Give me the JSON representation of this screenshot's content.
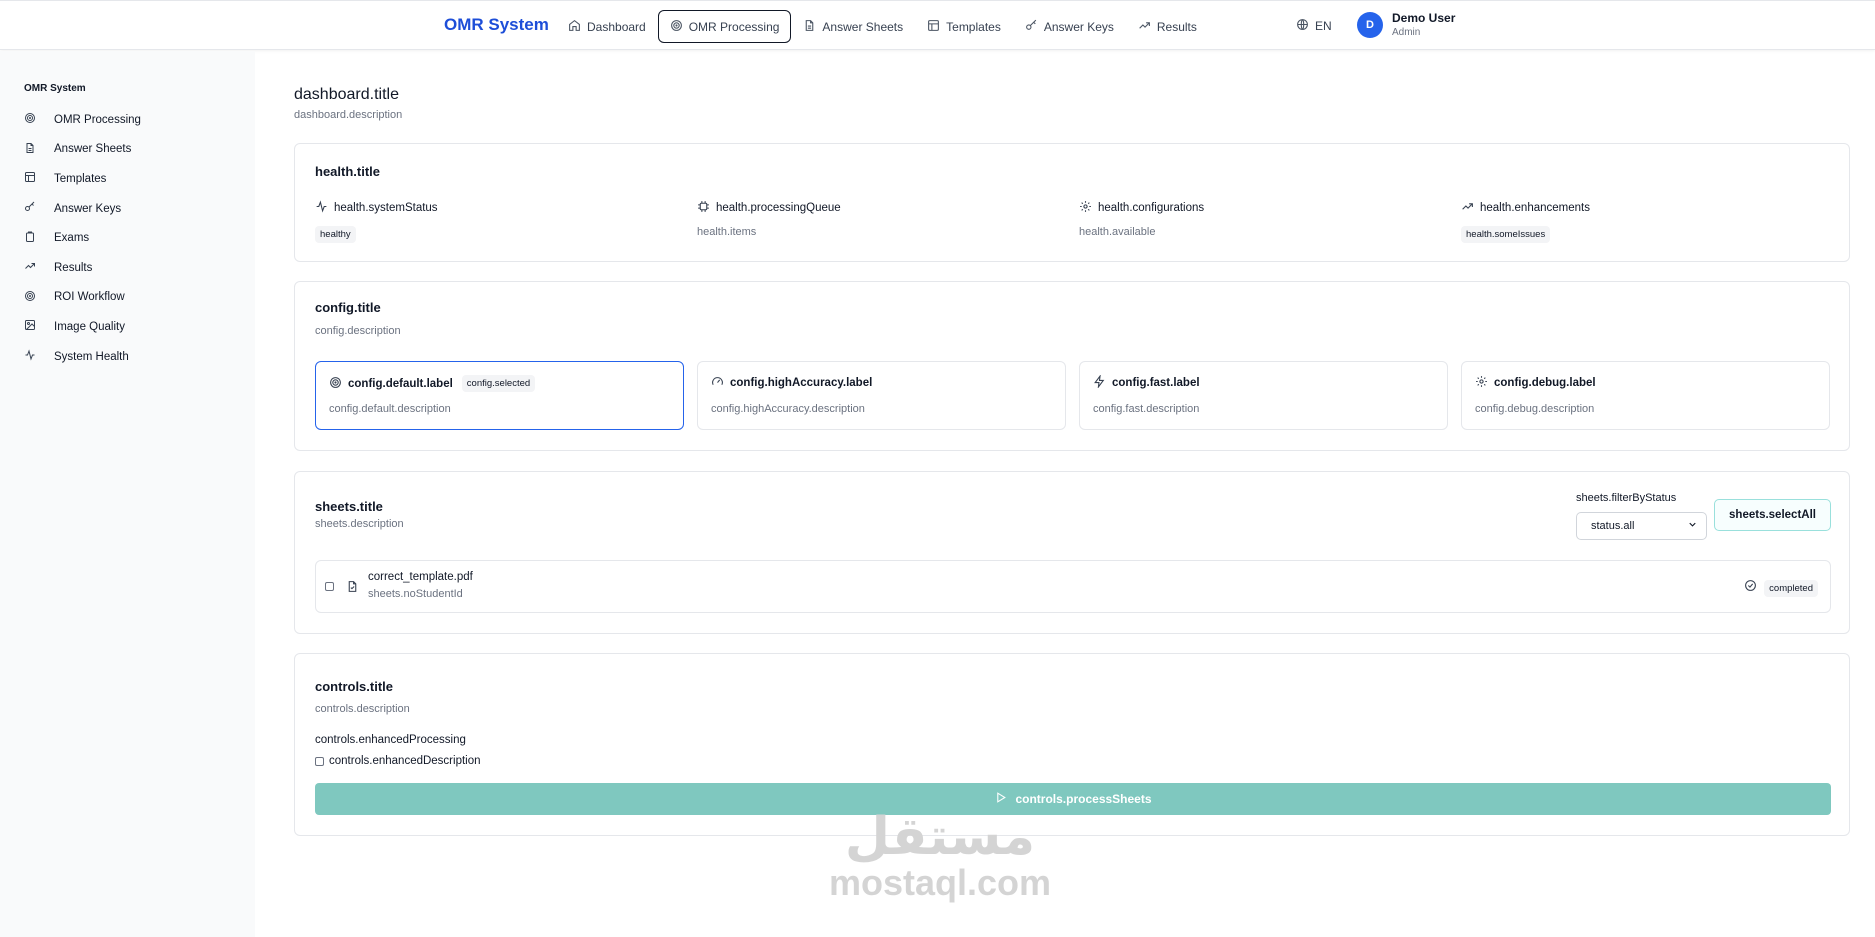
{
  "header": {
    "brand": "OMR System",
    "nav": [
      {
        "label": "Dashboard",
        "icon": "home-icon"
      },
      {
        "label": "OMR Processing",
        "icon": "target-icon",
        "active": true
      },
      {
        "label": "Answer Sheets",
        "icon": "file-icon"
      },
      {
        "label": "Templates",
        "icon": "layout-icon"
      },
      {
        "label": "Answer Keys",
        "icon": "key-icon"
      },
      {
        "label": "Results",
        "icon": "trending-up-icon"
      }
    ],
    "language": "EN",
    "user": {
      "initial": "D",
      "name": "Demo User",
      "role": "Admin"
    }
  },
  "sidebar": {
    "title": "OMR System",
    "items": [
      {
        "label": "OMR Processing",
        "icon": "target-icon"
      },
      {
        "label": "Answer Sheets",
        "icon": "file-icon"
      },
      {
        "label": "Templates",
        "icon": "layout-icon"
      },
      {
        "label": "Answer Keys",
        "icon": "key-icon"
      },
      {
        "label": "Exams",
        "icon": "clipboard-icon"
      },
      {
        "label": "Results",
        "icon": "trending-up-icon"
      },
      {
        "label": "ROI Workflow",
        "icon": "target-icon"
      },
      {
        "label": "Image Quality",
        "icon": "image-icon"
      },
      {
        "label": "System Health",
        "icon": "activity-icon"
      }
    ]
  },
  "page": {
    "title": "dashboard.title",
    "description": "dashboard.description"
  },
  "health": {
    "title": "health.title",
    "items": [
      {
        "label": "health.systemStatus",
        "value": "healthy",
        "pill": true,
        "icon": "activity-icon"
      },
      {
        "label": "health.processingQueue",
        "value": "health.items",
        "pill": false,
        "icon": "cpu-icon"
      },
      {
        "label": "health.configurations",
        "value": "health.available",
        "pill": false,
        "icon": "gear-icon"
      },
      {
        "label": "health.enhancements",
        "value": "health.someIssues",
        "pill": true,
        "icon": "trending-up-icon"
      }
    ]
  },
  "config": {
    "title": "config.title",
    "description": "config.description",
    "options": [
      {
        "label": "config.default.label",
        "description": "config.default.description",
        "badge": "config.selected",
        "selected": true,
        "icon": "target-icon"
      },
      {
        "label": "config.highAccuracy.label",
        "description": "config.highAccuracy.description",
        "selected": false,
        "icon": "gauge-icon"
      },
      {
        "label": "config.fast.label",
        "description": "config.fast.description",
        "selected": false,
        "icon": "zap-icon"
      },
      {
        "label": "config.debug.label",
        "description": "config.debug.description",
        "selected": false,
        "icon": "gear-icon"
      }
    ]
  },
  "sheets": {
    "title": "sheets.title",
    "description": "sheets.description",
    "filter_label": "sheets.filterByStatus",
    "filter_value": "status.all",
    "select_all": "sheets.selectAll",
    "items": [
      {
        "name": "correct_template.pdf",
        "sub": "sheets.noStudentId",
        "status": "completed"
      }
    ]
  },
  "controls": {
    "title": "controls.title",
    "description": "controls.description",
    "enhanced_label": "controls.enhancedProcessing",
    "enhanced_description": "controls.enhancedDescription",
    "process_button": "controls.processSheets"
  },
  "watermark": {
    "arabic": "مستقل",
    "latin": "mostaql.com"
  },
  "colors": {
    "brand": "#1d4ed8",
    "selected_border": "#2563eb",
    "process_button": "#7fc8bf",
    "select_all_border": "#99e0dc"
  }
}
